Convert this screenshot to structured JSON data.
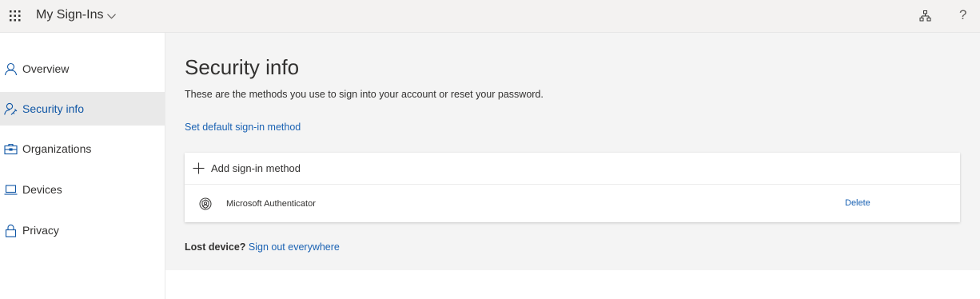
{
  "header": {
    "app_title": "My Sign-Ins",
    "icons": {
      "waffle": "app-launcher-icon",
      "chevron": "chevron-down-icon",
      "org": "organization-chart-icon",
      "help": "help-icon"
    },
    "help_glyph": "?"
  },
  "sidebar": {
    "items": [
      {
        "label": "Overview",
        "icon": "person-icon",
        "active": false
      },
      {
        "label": "Security info",
        "icon": "person-key-icon",
        "active": true
      },
      {
        "label": "Organizations",
        "icon": "briefcase-icon",
        "active": false
      },
      {
        "label": "Devices",
        "icon": "laptop-icon",
        "active": false
      },
      {
        "label": "Privacy",
        "icon": "lock-icon",
        "active": false
      }
    ]
  },
  "main": {
    "title": "Security info",
    "subtitle": "These are the methods you use to sign into your account or reset your password.",
    "default_link": "Set default sign-in method",
    "add_method_label": "Add sign-in method",
    "methods": [
      {
        "name": "Microsoft Authenticator",
        "icon": "authenticator-icon",
        "action": "Delete"
      }
    ],
    "lost_device_label": "Lost device?",
    "sign_out_link": "Sign out everywhere"
  },
  "colors": {
    "link": "#1a62b3",
    "active_nav_text": "#0f56a5",
    "active_nav_bg": "#e9e9e9",
    "header_bg": "#f3f2f1",
    "main_bg": "#f4f4f4"
  }
}
